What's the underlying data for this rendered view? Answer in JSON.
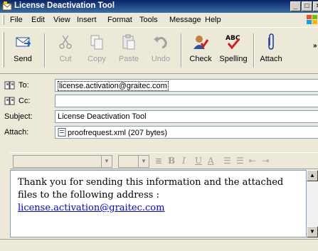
{
  "window": {
    "title": "License Deactivation Tool"
  },
  "menu": [
    "File",
    "Edit",
    "View",
    "Insert",
    "Format",
    "Tools",
    "Message",
    "Help"
  ],
  "toolbar": {
    "buttons": [
      {
        "label": "Send",
        "icon": "send-icon",
        "enabled": true
      },
      {
        "label": "Cut",
        "icon": "scissors-icon",
        "enabled": false
      },
      {
        "label": "Copy",
        "icon": "copy-icon",
        "enabled": false
      },
      {
        "label": "Paste",
        "icon": "paste-icon",
        "enabled": false
      },
      {
        "label": "Undo",
        "icon": "undo-icon",
        "enabled": false
      },
      {
        "label": "Check",
        "icon": "check-names-icon",
        "enabled": true
      },
      {
        "label": "Spelling",
        "icon": "spelling-icon",
        "enabled": true
      },
      {
        "label": "Attach",
        "icon": "paperclip-icon",
        "enabled": true
      }
    ],
    "spelling_glyph": "ABC"
  },
  "header": {
    "to_label": "To:",
    "to_value": "license.activation@graitec.com",
    "cc_label": "Cc:",
    "cc_value": "",
    "subject_label": "Subject:",
    "subject_value": "License Deactivation Tool",
    "attach_label": "Attach:",
    "attach_value": "proofrequest.xml (207 bytes)"
  },
  "format_bar": {
    "items": [
      "B",
      "I",
      "U",
      "A"
    ]
  },
  "body": {
    "text": "Thank you for sending this information and the attached files to the following address : ",
    "link": "license.activation@graitec.com"
  }
}
